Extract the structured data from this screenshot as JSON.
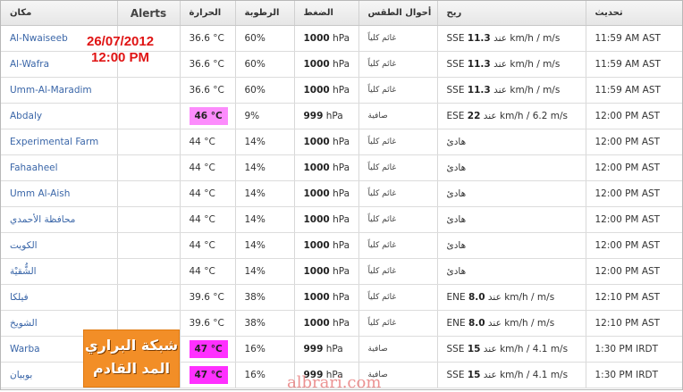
{
  "headers": {
    "location": "مكان",
    "alerts": "Alerts",
    "temp": "الحرارة",
    "humidity": "الرطوبة",
    "pressure": "الضغط",
    "conditions": "أحوال الطقس",
    "wind": "ريح",
    "updated": "تحديث"
  },
  "colors": {
    "orange_highlight": "#fc8cfc",
    "magenta_highlight": "#ff30ff"
  },
  "rows": [
    {
      "loc": "Al-Nwaiseeb",
      "temp": "36.6 °C",
      "hum": "60%",
      "press_num": "1000",
      "press_unit": "hPa",
      "cond": "غائم كلياً",
      "wind_dir": "SSE",
      "wind_num": "11.3",
      "wind_rest": "عند km/h /  m/s",
      "time": "11:59 AM AST"
    },
    {
      "loc": "Al-Wafra",
      "temp": "36.6 °C",
      "hum": "60%",
      "press_num": "1000",
      "press_unit": "hPa",
      "cond": "غائم كلياً",
      "wind_dir": "SSE",
      "wind_num": "11.3",
      "wind_rest": "عند km/h /  m/s",
      "time": "11:59 AM AST"
    },
    {
      "loc": "Umm-Al-Maradim",
      "temp": "36.6 °C",
      "hum": "60%",
      "press_num": "1000",
      "press_unit": "hPa",
      "cond": "غائم كلياً",
      "wind_dir": "SSE",
      "wind_num": "11.3",
      "wind_rest": "عند km/h /  m/s",
      "time": "11:59 AM AST"
    },
    {
      "loc": "Abdaly",
      "temp": "46 °C",
      "hum": "9%",
      "press_num": "999",
      "press_unit": "hPa",
      "cond": "صافية",
      "wind_dir": "ESE",
      "wind_num": "22",
      "wind_rest": "عند km/h / 6.2 m/s",
      "time": "12:00 PM AST"
    },
    {
      "loc": "Experimental Farm",
      "temp": "44 °C",
      "hum": "14%",
      "press_num": "1000",
      "press_unit": "hPa",
      "cond": "غائم كلياً",
      "wind_dir": "",
      "wind_num": "",
      "wind_rest": "هادئ",
      "time": "12:00 PM AST"
    },
    {
      "loc": "Fahaaheel",
      "temp": "44 °C",
      "hum": "14%",
      "press_num": "1000",
      "press_unit": "hPa",
      "cond": "غائم كلياً",
      "wind_dir": "",
      "wind_num": "",
      "wind_rest": "هادئ",
      "time": "12:00 PM AST"
    },
    {
      "loc": "Umm Al-Aish",
      "temp": "44 °C",
      "hum": "14%",
      "press_num": "1000",
      "press_unit": "hPa",
      "cond": "غائم كلياً",
      "wind_dir": "",
      "wind_num": "",
      "wind_rest": "هادئ",
      "time": "12:00 PM AST"
    },
    {
      "loc": "محافظة الأحمدي",
      "temp": "44 °C",
      "hum": "14%",
      "press_num": "1000",
      "press_unit": "hPa",
      "cond": "غائم كلياً",
      "wind_dir": "",
      "wind_num": "",
      "wind_rest": "هادئ",
      "time": "12:00 PM AST"
    },
    {
      "loc": "الكويت",
      "temp": "44 °C",
      "hum": "14%",
      "press_num": "1000",
      "press_unit": "hPa",
      "cond": "غائم كلياً",
      "wind_dir": "",
      "wind_num": "",
      "wind_rest": "هادئ",
      "time": "12:00 PM AST"
    },
    {
      "loc": "الشُّقيْة",
      "temp": "44 °C",
      "hum": "14%",
      "press_num": "1000",
      "press_unit": "hPa",
      "cond": "غائم كلياً",
      "wind_dir": "",
      "wind_num": "",
      "wind_rest": "هادئ",
      "time": "12:00 PM AST"
    },
    {
      "loc": "فيلكا",
      "temp": "39.6 °C",
      "hum": "38%",
      "press_num": "1000",
      "press_unit": "hPa",
      "cond": "غائم كلياً",
      "wind_dir": "ENE",
      "wind_num": "8.0",
      "wind_rest": "عند km/h /  m/s",
      "time": "12:10 PM AST"
    },
    {
      "loc": "الشويخ",
      "temp": "39.6 °C",
      "hum": "38%",
      "press_num": "1000",
      "press_unit": "hPa",
      "cond": "غائم كلياً",
      "wind_dir": "ENE",
      "wind_num": "8.0",
      "wind_rest": "عند km/h /  m/s",
      "time": "12:10 PM AST"
    },
    {
      "loc": "Warba",
      "temp": "47 °C",
      "hum": "16%",
      "press_num": "999",
      "press_unit": "hPa",
      "cond": "صافية",
      "wind_dir": "SSE",
      "wind_num": "15",
      "wind_rest": "عند km/h / 4.1 m/s",
      "time": "1:30 PM IRDT"
    },
    {
      "loc": "بوبيان",
      "temp": "47 °C",
      "hum": "16%",
      "press_num": "999",
      "press_unit": "hPa",
      "cond": "صافية",
      "wind_dir": "SSE",
      "wind_num": "15",
      "wind_rest": "عند km/h / 4.1 m/s",
      "time": "1:30 PM IRDT"
    }
  ],
  "annotation": {
    "date": "26/07/2012",
    "time": "12:00 PM"
  },
  "logo": {
    "line1": "شبكة البراري",
    "line2": "المد القادم"
  },
  "watermark": "albrari.com"
}
